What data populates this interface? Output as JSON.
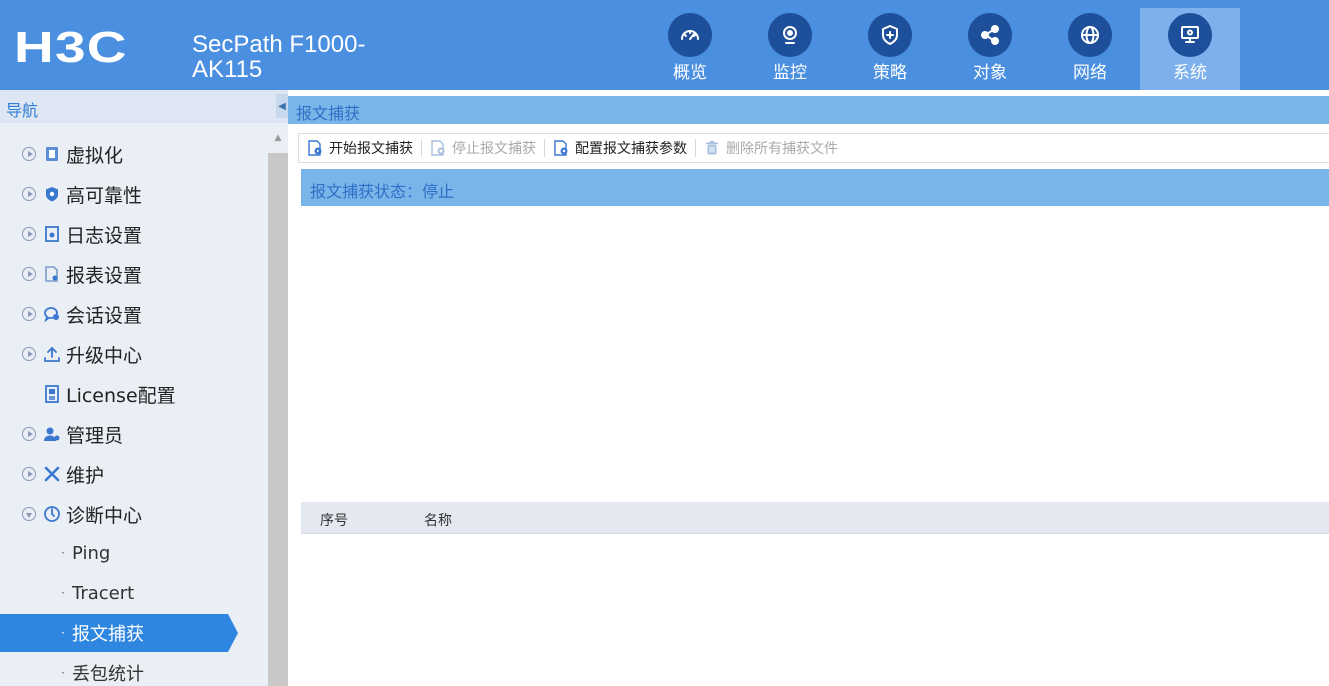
{
  "header": {
    "logo": "H3C",
    "product_line1": "SecPath F1000-",
    "product_line2": "AK115",
    "nav": [
      {
        "label": "概览",
        "icon": "dashboard-icon",
        "active": false
      },
      {
        "label": "监控",
        "icon": "webcam-icon",
        "active": false
      },
      {
        "label": "策略",
        "icon": "shield-plus-icon",
        "active": false
      },
      {
        "label": "对象",
        "icon": "share-nodes-icon",
        "active": false
      },
      {
        "label": "网络",
        "icon": "globe-icon",
        "active": false
      },
      {
        "label": "系统",
        "icon": "monitor-gear-icon",
        "active": true
      }
    ]
  },
  "sidebar": {
    "title": "导航",
    "items": [
      {
        "label": "虚拟化",
        "icon": "virtualization-icon",
        "expandable": true
      },
      {
        "label": "高可靠性",
        "icon": "shield-icon",
        "expandable": true
      },
      {
        "label": "日志设置",
        "icon": "log-settings-icon",
        "expandable": true
      },
      {
        "label": "报表设置",
        "icon": "report-settings-icon",
        "expandable": true
      },
      {
        "label": "会话设置",
        "icon": "session-settings-icon",
        "expandable": true
      },
      {
        "label": "升级中心",
        "icon": "upload-icon",
        "expandable": true
      },
      {
        "label": "License配置",
        "icon": "license-icon",
        "expandable": false
      },
      {
        "label": "管理员",
        "icon": "admin-users-icon",
        "expandable": true
      },
      {
        "label": "维护",
        "icon": "tools-icon",
        "expandable": true
      },
      {
        "label": "诊断中心",
        "icon": "diagnosis-icon",
        "expandable": true,
        "expanded": true
      }
    ],
    "subitems": [
      {
        "label": "Ping",
        "active": false
      },
      {
        "label": "Tracert",
        "active": false
      },
      {
        "label": "报文捕获",
        "active": true
      },
      {
        "label": "丢包统计",
        "active": false
      }
    ]
  },
  "main": {
    "title": "报文捕获",
    "toolbar": {
      "start": "开始报文捕获",
      "stop": "停止报文捕获",
      "config": "配置报文捕获参数",
      "delete_all": "删除所有捕获文件"
    },
    "status": "报文捕获状态：停止",
    "table": {
      "columns": [
        "序号",
        "名称"
      ],
      "rows": []
    }
  },
  "colors": {
    "header_bg": "#4a8fe0",
    "nav_icon_bg": "#1d4f9a",
    "active_item": "#2f86e0",
    "title_bar": "#7ab5ea"
  }
}
